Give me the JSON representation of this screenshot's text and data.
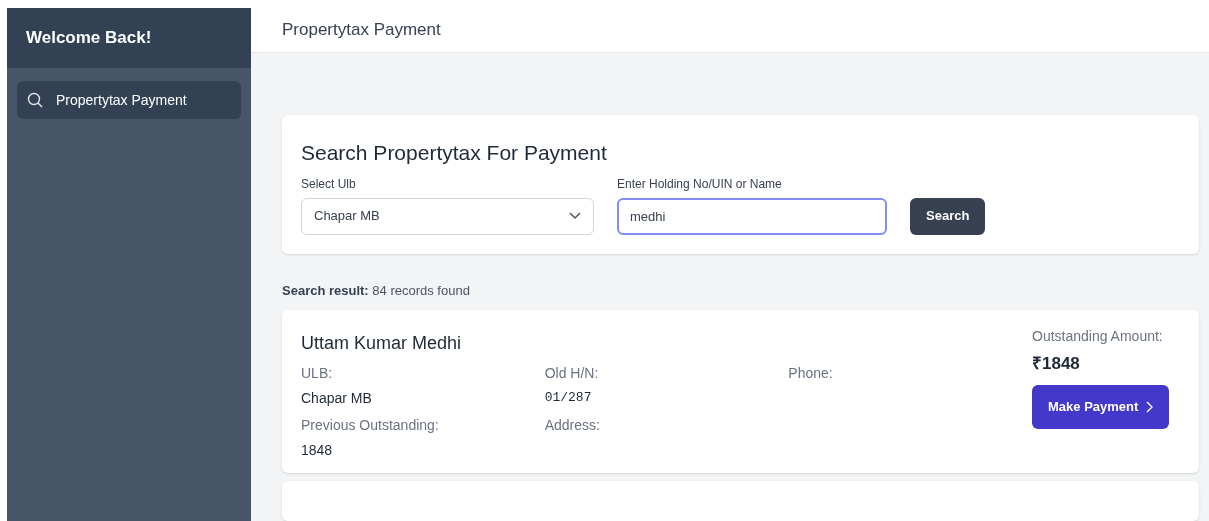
{
  "sidebar": {
    "title": "Welcome Back!",
    "items": [
      {
        "label": "Propertytax Payment",
        "selected": true
      }
    ]
  },
  "header": {
    "title": "Propertytax Payment"
  },
  "search_card": {
    "title": "Search Propertytax For Payment",
    "ulb_label": "Select Ulb",
    "ulb_value": "Chapar MB",
    "query_label": "Enter Holding No/UIN or Name",
    "query_value": "medhi",
    "button": "Search"
  },
  "result_summary": {
    "label": "Search result:",
    "text": "84 records found"
  },
  "results": [
    {
      "name": "Uttam Kumar Medhi",
      "ulb_label": "ULB:",
      "ulb": "Chapar MB",
      "old_hn_label": "Old H/N:",
      "old_hn": "01/287",
      "phone_label": "Phone:",
      "prev_label": "Previous Outstanding:",
      "prev": "1848",
      "address_label": "Address:",
      "amount_label": "Outstanding Amount:",
      "amount": "₹1848",
      "button": "Make Payment"
    }
  ]
}
